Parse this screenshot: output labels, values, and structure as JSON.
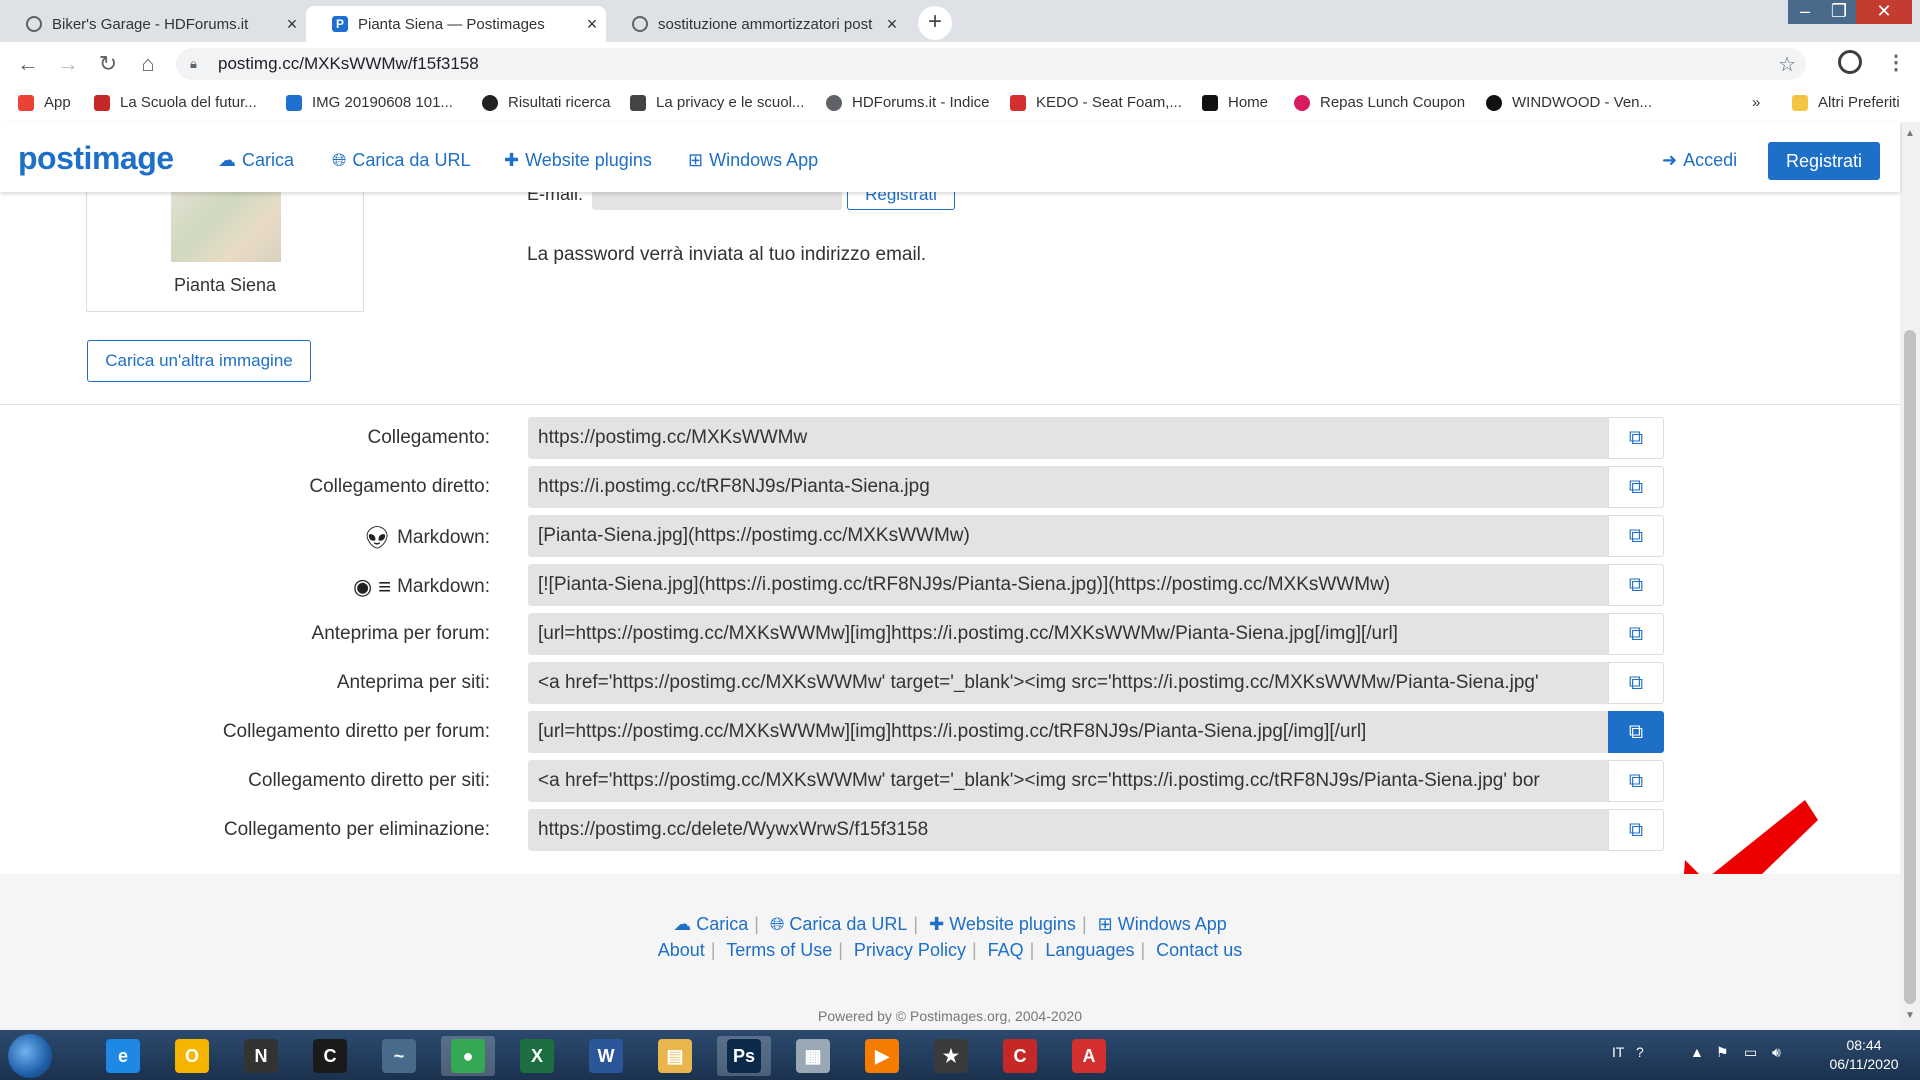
{
  "browser": {
    "tabs": [
      {
        "title": "Biker's Garage - HDForums.it",
        "active": false
      },
      {
        "title": "Pianta Siena — Postimages",
        "active": true
      },
      {
        "title": "sostituzione ammortizzatori post",
        "active": false
      }
    ],
    "address": "postimg.cc/MXKsWWMw/f15f3158",
    "bookmarks": [
      {
        "label": "App",
        "color": "#ea4335"
      },
      {
        "label": "La Scuola del futur...",
        "color": "#c62828"
      },
      {
        "label": "IMG 20190608 101...",
        "color": "#1f6fd1"
      },
      {
        "label": "Risultati ricerca",
        "color": "#222222"
      },
      {
        "label": "La privacy e le scuol...",
        "color": "#444444"
      },
      {
        "label": "HDForums.it - Indice",
        "color": "#5f6368"
      },
      {
        "label": "KEDO - Seat Foam,...",
        "color": "#d32f2f"
      },
      {
        "label": "Home",
        "color": "#111111"
      },
      {
        "label": "Repas Lunch Coupon",
        "color": "#d81b60"
      },
      {
        "label": "WINDWOOD - Ven...",
        "color": "#111111"
      }
    ],
    "bookmarks_overflow": "»",
    "other_bookmarks": "Altri Preferiti"
  },
  "header": {
    "logo": "postimage",
    "nav": [
      {
        "label": "Carica",
        "icon": "cloud-upload-icon"
      },
      {
        "label": "Carica da URL",
        "icon": "globe-icon"
      },
      {
        "label": "Website plugins",
        "icon": "puzzle-icon"
      },
      {
        "label": "Windows App",
        "icon": "windows-icon"
      }
    ],
    "login": "Accedi",
    "register": "Registrati"
  },
  "upload": {
    "thumb_caption": "Pianta Siena",
    "email_label": "E-mail:",
    "register_small": "Registrati",
    "password_note": "La password verrà inviata al tuo indirizzo email.",
    "another_image": "Carica un'altra immagine"
  },
  "links": [
    {
      "label": "Collegamento:",
      "value": "https://postimg.cc/MXKsWWMw",
      "icon": ""
    },
    {
      "label": "Collegamento diretto:",
      "value": "https://i.postimg.cc/tRF8NJ9s/Pianta-Siena.jpg",
      "icon": ""
    },
    {
      "label": "Markdown:",
      "value": "[Pianta-Siena.jpg](https://postimg.cc/MXKsWWMw)",
      "icon": "reddit-icon"
    },
    {
      "label": "Markdown:",
      "value": "[![Pianta-Siena.jpg](https://i.postimg.cc/tRF8NJ9s/Pianta-Siena.jpg)](https://postimg.cc/MXKsWWMw)",
      "icon": "github-stackoverflow-icon"
    },
    {
      "label": "Anteprima per forum:",
      "value": "[url=https://postimg.cc/MXKsWWMw][img]https://i.postimg.cc/MXKsWWMw/Pianta-Siena.jpg[/img][/url]",
      "icon": ""
    },
    {
      "label": "Anteprima per siti:",
      "value": "<a href='https://postimg.cc/MXKsWWMw' target='_blank'><img src='https://i.postimg.cc/MXKsWWMw/Pianta-Siena.jpg'",
      "icon": ""
    },
    {
      "label": "Collegamento diretto per forum:",
      "value": "[url=https://postimg.cc/MXKsWWMw][img]https://i.postimg.cc/tRF8NJ9s/Pianta-Siena.jpg[/img][/url]",
      "icon": ""
    },
    {
      "label": "Collegamento diretto per siti:",
      "value": "<a href='https://postimg.cc/MXKsWWMw' target='_blank'><img src='https://i.postimg.cc/tRF8NJ9s/Pianta-Siena.jpg' bor",
      "icon": ""
    },
    {
      "label": "Collegamento per eliminazione:",
      "value": "https://postimg.cc/delete/WywxWrwS/f15f3158",
      "icon": ""
    }
  ],
  "footer": {
    "row1": [
      "Carica",
      "Carica da URL",
      "Website plugins",
      "Windows App"
    ],
    "row2": [
      "About",
      "Terms of Use",
      "Privacy Policy",
      "FAQ",
      "Languages",
      "Contact us"
    ],
    "powered": "Powered by © Postimages.org, 2004-2020"
  },
  "taskbar": {
    "apps": [
      {
        "name": "internet-explorer",
        "color": "#1e88e5",
        "glyph": "e"
      },
      {
        "name": "outlook",
        "color": "#f4b400",
        "glyph": "O"
      },
      {
        "name": "nikon-transfer",
        "color": "#333333",
        "glyph": "N"
      },
      {
        "name": "capture-nx",
        "color": "#1a1a1a",
        "glyph": "C"
      },
      {
        "name": "feather-app",
        "color": "#4a6a8c",
        "glyph": "~"
      },
      {
        "name": "chrome",
        "color": "#34a853",
        "glyph": "●"
      },
      {
        "name": "excel",
        "color": "#1d6f42",
        "glyph": "X"
      },
      {
        "name": "word",
        "color": "#2b579a",
        "glyph": "W"
      },
      {
        "name": "explorer",
        "color": "#e8b64c",
        "glyph": "▤"
      },
      {
        "name": "photoshop",
        "color": "#0b2a4a",
        "glyph": "Ps"
      },
      {
        "name": "calculator",
        "color": "#9aa7b5",
        "glyph": "▦"
      },
      {
        "name": "media-player",
        "color": "#f57c00",
        "glyph": "▶"
      },
      {
        "name": "movie-maker",
        "color": "#3a3a3a",
        "glyph": "★"
      },
      {
        "name": "ccleaner",
        "color": "#c62828",
        "glyph": "C"
      },
      {
        "name": "acrobat",
        "color": "#d32f2f",
        "glyph": "A"
      }
    ],
    "lang": "IT",
    "time": "08:44",
    "date": "06/11/2020"
  }
}
